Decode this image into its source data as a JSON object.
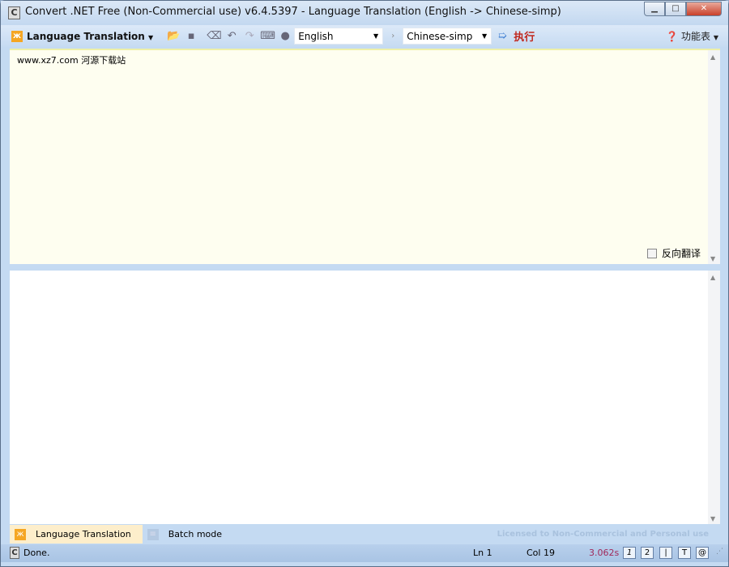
{
  "window": {
    "title": "Convert .NET Free (Non-Commercial use) v6.4.5397 - Language Translation (English -> Chinese-simp)",
    "app_icon": "C"
  },
  "toolbar": {
    "mode_label": "Language Translation",
    "source_lang": "English",
    "separator": "›",
    "target_lang": "Chinese-simp",
    "run_label": "执行",
    "menu_label": "功能表"
  },
  "input": {
    "text": "www.xz7.com 河源下载站",
    "reverse_label": "反向翻译",
    "reverse_checked": false
  },
  "output": {
    "text": ""
  },
  "tabs": [
    {
      "label": "Language Translation",
      "active": true
    },
    {
      "label": "Batch mode",
      "active": false
    }
  ],
  "license": "Licensed to Non-Commercial and Personal use",
  "status": {
    "text": "Done.",
    "ln": "Ln 1",
    "col": "Col 19",
    "time": "3.062s",
    "buttons": [
      "1",
      "2",
      "|",
      "T",
      "@"
    ]
  }
}
